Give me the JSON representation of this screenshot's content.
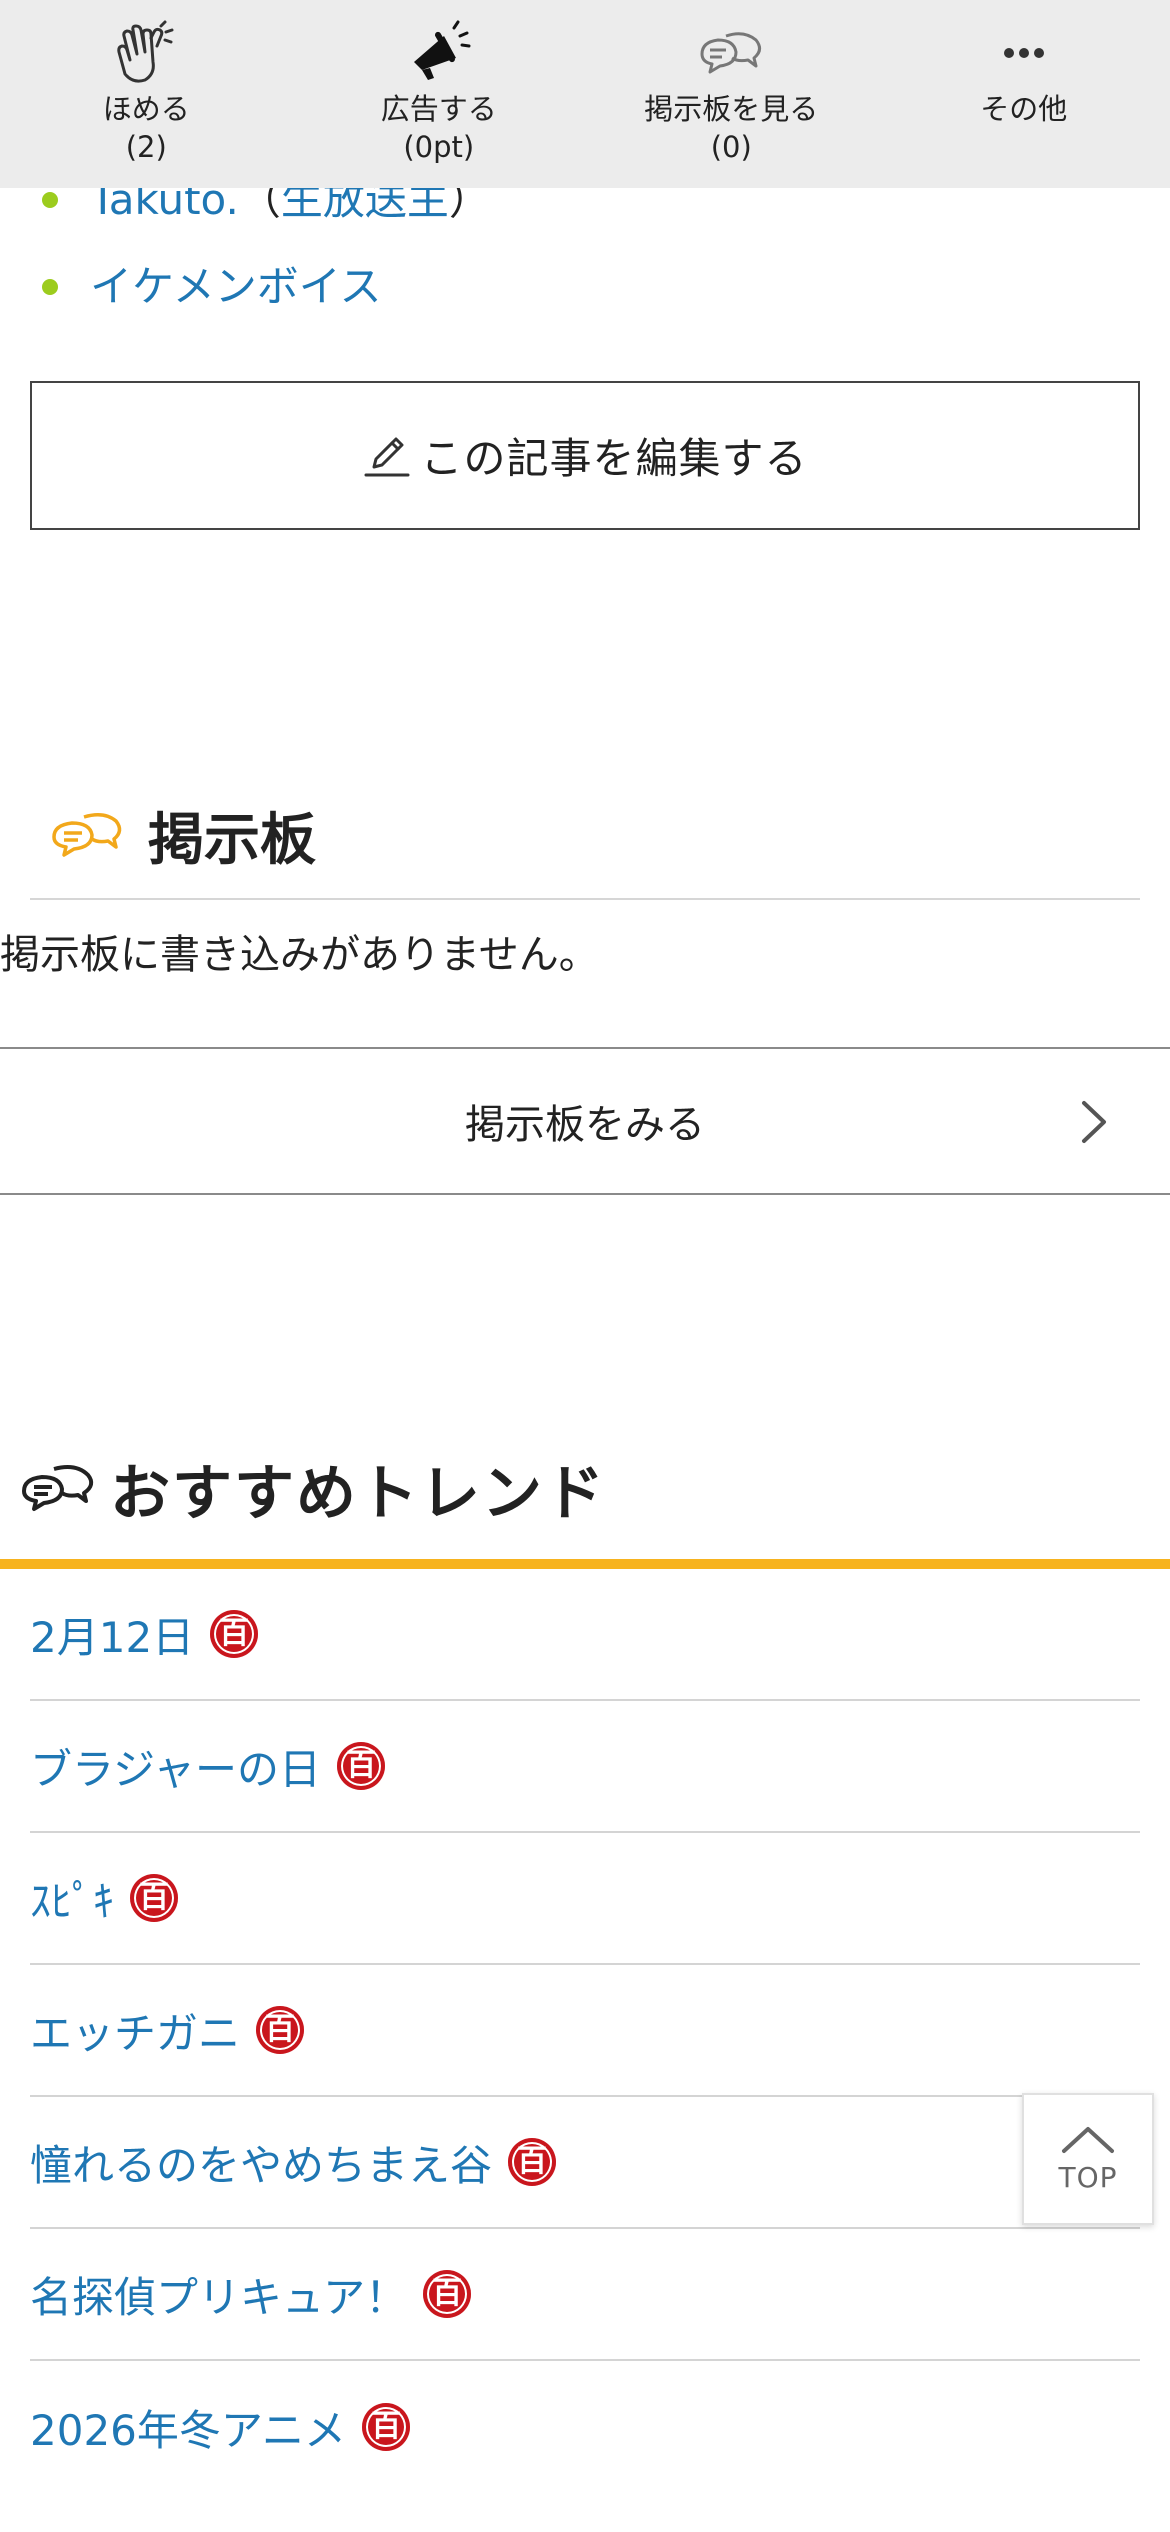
{
  "topbar": {
    "actions": [
      {
        "label": "ほめる",
        "count": "(2)"
      },
      {
        "label": "広告する",
        "count": "(0pt)"
      },
      {
        "label": "掲示板を見る",
        "count": "(0)"
      },
      {
        "label": "その他",
        "count": ""
      }
    ]
  },
  "related": {
    "items": [
      {
        "name": "Takuto.",
        "open_paren": "（",
        "role": "生放送主",
        "close_paren": "）"
      },
      {
        "name": "イケメンボイス"
      }
    ]
  },
  "edit_button": {
    "label": "この記事を編集する"
  },
  "bbs": {
    "title": "掲示板",
    "empty_message": "掲示板に書き込みがありません。",
    "view_label": "掲示板をみる"
  },
  "trends": {
    "title": "おすすめトレンド",
    "badge_glyph": "百",
    "items": [
      "2月12日",
      "ブラジャーの日",
      "ｽﾋﾟｷ",
      "エッチガニ",
      "憧れるのをやめちまえ谷",
      "名探偵プリキュア！",
      "2026年冬アニメ"
    ]
  },
  "top_button": {
    "label": "TOP"
  },
  "colors": {
    "link": "#1f77b4",
    "accent_bar": "#f7b31e",
    "badge": "#c9161d",
    "bullet": "#9ccc1e"
  }
}
